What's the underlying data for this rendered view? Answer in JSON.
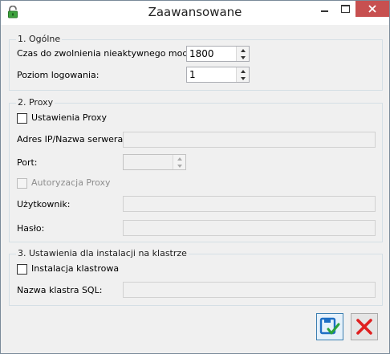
{
  "window": {
    "title": "Zaawansowane"
  },
  "general": {
    "title": "1. Ogólne",
    "idle_label": "Czas do zwolnienia nieaktywnego modułu:",
    "idle_value": "1800",
    "log_label": "Poziom logowania:",
    "log_value": "1"
  },
  "proxy": {
    "title": "2. Proxy",
    "settings_label": "Ustawienia Proxy",
    "settings_checked": false,
    "address_label": "Adres IP/Nazwa serwera:",
    "address_value": "",
    "port_label": "Port:",
    "port_value": "",
    "auth_label": "Autoryzacja Proxy",
    "auth_checked": false,
    "user_label": "Użytkownik:",
    "user_value": "",
    "password_label": "Hasło:",
    "password_value": ""
  },
  "cluster": {
    "title": "3. Ustawienia dla instalacji na klastrze",
    "install_label": "Instalacja klastrowa",
    "install_checked": false,
    "sql_label": "Nazwa klastra SQL:",
    "sql_value": ""
  },
  "icons": {
    "app": "lock-icon",
    "save": "save-icon",
    "cancel": "cancel-icon",
    "minimize": "minimize-icon",
    "maximize": "maximize-icon",
    "close": "close-icon"
  },
  "colors": {
    "close_button": "#c75050",
    "save_accent": "#1e6fc4",
    "check_green": "#2aa33a",
    "cancel_red": "#e02020",
    "lock_green": "#3ea33e"
  }
}
